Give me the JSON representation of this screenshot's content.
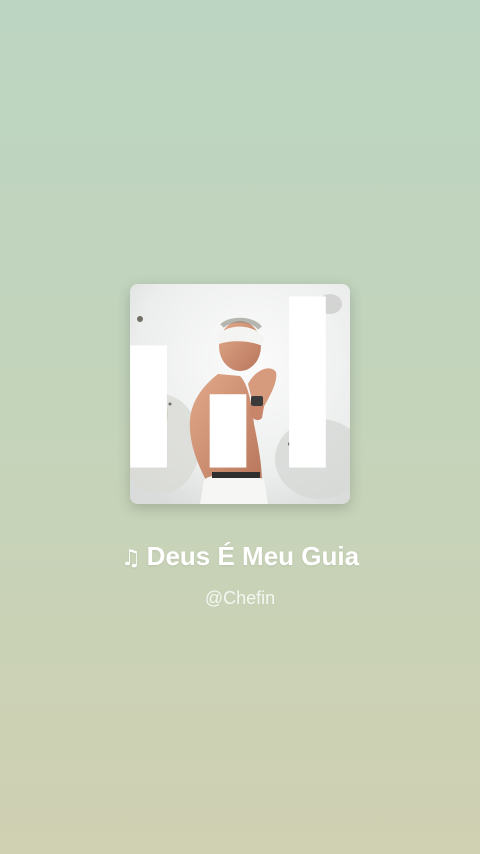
{
  "song": {
    "note_icon": "♫",
    "title": "Deus É Meu Guia",
    "artist": "@Chefin"
  },
  "cover": {
    "icon": "album-art-image",
    "badge_icon": "audio-bars-icon"
  },
  "colors": {
    "background_top": "#bcd5c2",
    "background_bottom": "#d0d0b2",
    "text": "#ffffff"
  }
}
